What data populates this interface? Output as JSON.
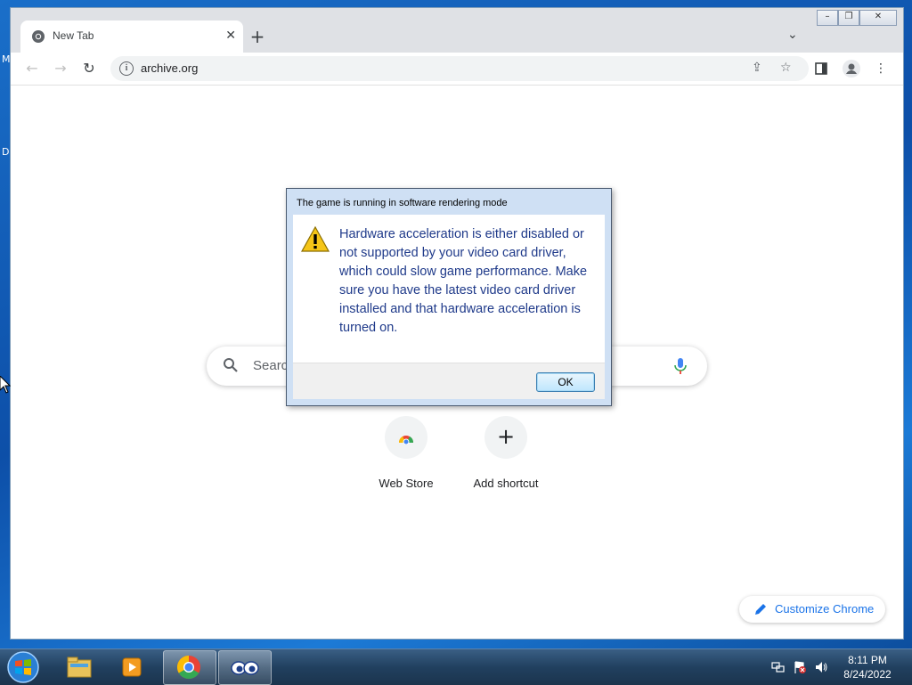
{
  "desktop": {
    "edge_letters": [
      "M",
      "D"
    ]
  },
  "browser": {
    "tab": {
      "title": "New Tab"
    },
    "omnibox": {
      "url": "archive.org"
    }
  },
  "ntp": {
    "search_placeholder": "Searc",
    "shortcuts": [
      {
        "label": "Web Store",
        "icon": "chrome-web-store-icon"
      },
      {
        "label": "Add shortcut",
        "icon": "plus-icon"
      }
    ],
    "customize_label": "Customize Chrome"
  },
  "dialog": {
    "title": "The game is running in software rendering mode",
    "message": "Hardware acceleration is either disabled or not supported by your video card driver, which could slow game performance. Make sure you have the latest video card driver installed and that hardware acceleration is turned on.",
    "ok_label": "OK"
  },
  "taskbar": {
    "apps": [
      "windows-explorer-icon",
      "media-player-icon",
      "chrome-icon",
      "game-eyes-icon"
    ],
    "clock": {
      "time": "8:11 PM",
      "date": "8/24/2022"
    }
  },
  "colors": {
    "accent": "#1a73e8",
    "dialog_text": "#1f3a8a"
  }
}
